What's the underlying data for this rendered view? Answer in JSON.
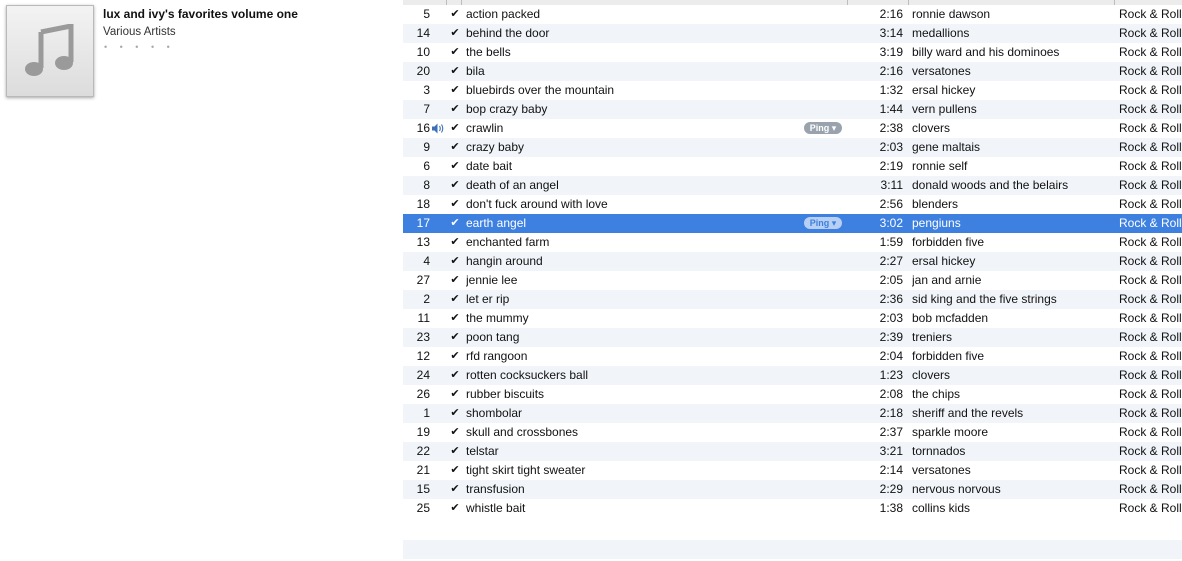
{
  "album": {
    "title": "lux and ivy's favorites volume one",
    "artist": "Various Artists",
    "rating_dots": "• • • • •",
    "artwork_icon": "music-note-icon"
  },
  "ping_label": "Ping ▾",
  "colors": {
    "selection": "#3d80df",
    "stripe": "#f1f5fa"
  },
  "tracks": [
    {
      "num": "5",
      "name": "action packed",
      "time": "2:16",
      "artist": "ronnie dawson",
      "genre": "Rock & Roll"
    },
    {
      "num": "14",
      "name": "behind the door",
      "time": "3:14",
      "artist": "medallions",
      "genre": "Rock & Roll"
    },
    {
      "num": "10",
      "name": "the bells",
      "time": "3:19",
      "artist": "billy ward and his dominoes",
      "genre": "Rock & Roll"
    },
    {
      "num": "20",
      "name": "bila",
      "time": "2:16",
      "artist": "versatones",
      "genre": "Rock & Roll"
    },
    {
      "num": "3",
      "name": "bluebirds over the mountain",
      "time": "1:32",
      "artist": "ersal hickey",
      "genre": "Rock & Roll"
    },
    {
      "num": "7",
      "name": "bop crazy baby",
      "time": "1:44",
      "artist": "vern pullens",
      "genre": "Rock & Roll"
    },
    {
      "num": "16",
      "name": "crawlin",
      "time": "2:38",
      "artist": "clovers",
      "genre": "Rock & Roll",
      "playing": true,
      "ping": true
    },
    {
      "num": "9",
      "name": "crazy baby",
      "time": "2:03",
      "artist": "gene maltais",
      "genre": "Rock & Roll"
    },
    {
      "num": "6",
      "name": "date bait",
      "time": "2:19",
      "artist": "ronnie self",
      "genre": "Rock & Roll"
    },
    {
      "num": "8",
      "name": "death of an angel",
      "time": "3:11",
      "artist": "donald woods and the belairs",
      "genre": "Rock & Roll"
    },
    {
      "num": "18",
      "name": "don't fuck around with love",
      "time": "2:56",
      "artist": "blenders",
      "genre": "Rock & Roll"
    },
    {
      "num": "17",
      "name": "earth angel",
      "time": "3:02",
      "artist": "pengiuns",
      "genre": "Rock & Roll",
      "selected": true,
      "ping": true
    },
    {
      "num": "13",
      "name": "enchanted farm",
      "time": "1:59",
      "artist": "forbidden five",
      "genre": "Rock & Roll"
    },
    {
      "num": "4",
      "name": "hangin around",
      "time": "2:27",
      "artist": "ersal hickey",
      "genre": "Rock & Roll"
    },
    {
      "num": "27",
      "name": "jennie lee",
      "time": "2:05",
      "artist": "jan and arnie",
      "genre": "Rock & Roll"
    },
    {
      "num": "2",
      "name": "let er rip",
      "time": "2:36",
      "artist": "sid king and the five strings",
      "genre": "Rock & Roll"
    },
    {
      "num": "11",
      "name": "the mummy",
      "time": "2:03",
      "artist": "bob mcfadden",
      "genre": "Rock & Roll"
    },
    {
      "num": "23",
      "name": "poon tang",
      "time": "2:39",
      "artist": "treniers",
      "genre": "Rock & Roll"
    },
    {
      "num": "12",
      "name": "rfd rangoon",
      "time": "2:04",
      "artist": "forbidden five",
      "genre": "Rock & Roll"
    },
    {
      "num": "24",
      "name": "rotten cocksuckers ball",
      "time": "1:23",
      "artist": "clovers",
      "genre": "Rock & Roll"
    },
    {
      "num": "26",
      "name": "rubber biscuits",
      "time": "2:08",
      "artist": "the chips",
      "genre": "Rock & Roll"
    },
    {
      "num": "1",
      "name": "shombolar",
      "time": "2:18",
      "artist": "sheriff and the revels",
      "genre": "Rock & Roll"
    },
    {
      "num": "19",
      "name": "skull and crossbones",
      "time": "2:37",
      "artist": "sparkle moore",
      "genre": "Rock & Roll"
    },
    {
      "num": "22",
      "name": "telstar",
      "time": "3:21",
      "artist": "tornnados",
      "genre": "Rock & Roll"
    },
    {
      "num": "21",
      "name": "tight skirt tight sweater",
      "time": "2:14",
      "artist": "versatones",
      "genre": "Rock & Roll"
    },
    {
      "num": "15",
      "name": "transfusion",
      "time": "2:29",
      "artist": "nervous norvous",
      "genre": "Rock & Roll"
    },
    {
      "num": "25",
      "name": "whistle bait",
      "time": "1:38",
      "artist": "collins kids",
      "genre": "Rock & Roll"
    }
  ]
}
